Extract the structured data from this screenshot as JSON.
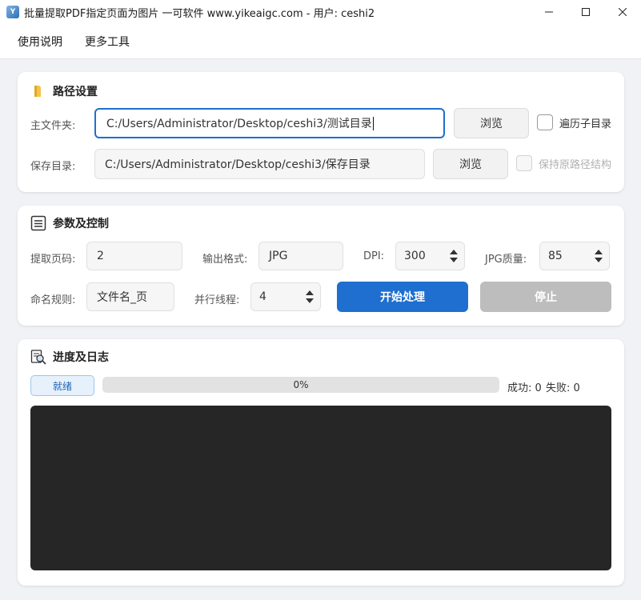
{
  "window": {
    "title": "批量提取PDF指定页面为图片 一可软件 www.yikeaigc.com - 用户: ceshi2"
  },
  "menu": [
    "使用说明",
    "更多工具"
  ],
  "path_section": {
    "title": "路径设置",
    "main_folder_label": "主文件夹:",
    "main_folder_value": "C:/Users/Administrator/Desktop/ceshi3/测试目录",
    "browse_label": "浏览",
    "recurse_label": "遍历子目录",
    "save_dir_label": "保存目录:",
    "save_dir_value": "C:/Users/Administrator/Desktop/ceshi3/保存目录",
    "browse2_label": "浏览",
    "keep_structure_label": "保持原路径结构"
  },
  "params_section": {
    "title": "参数及控制",
    "page_label": "提取页码:",
    "page_value": "2",
    "format_label": "输出格式:",
    "format_value": "JPG",
    "dpi_label": "DPI:",
    "dpi_value": "300",
    "quality_label": "JPG质量:",
    "quality_value": "85",
    "naming_label": "命名规则:",
    "naming_value": "文件名_页",
    "threads_label": "并行线程:",
    "threads_value": "4",
    "start_label": "开始处理",
    "stop_label": "停止"
  },
  "progress_section": {
    "title": "进度及日志",
    "status_badge": "就绪",
    "progress_percent": 0,
    "progress_text": "0%",
    "success_text": "成功: 0",
    "fail_text": "失败: 0"
  },
  "colors": {
    "accent": "#1f6fd0",
    "log_bg": "#262626",
    "page_bg": "#f0f2f5"
  }
}
